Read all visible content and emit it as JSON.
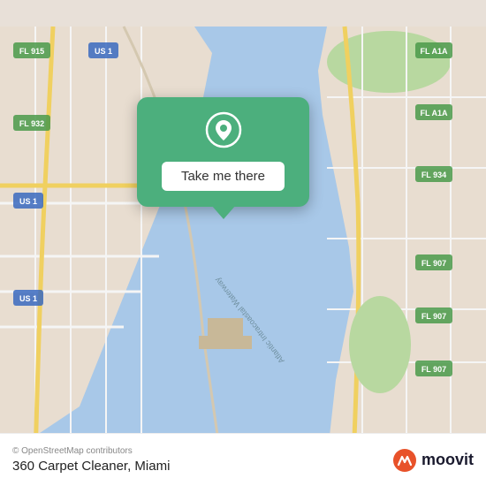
{
  "map": {
    "background_color": "#e8ddd0",
    "attribution": "© OpenStreetMap contributors",
    "location_name": "360 Carpet Cleaner, Miami"
  },
  "popup": {
    "button_label": "Take me there",
    "pin_color": "#ffffff",
    "background_color": "#4caf7d"
  },
  "branding": {
    "moovit_label": "moovit",
    "moovit_icon_color": "#e8522a"
  }
}
